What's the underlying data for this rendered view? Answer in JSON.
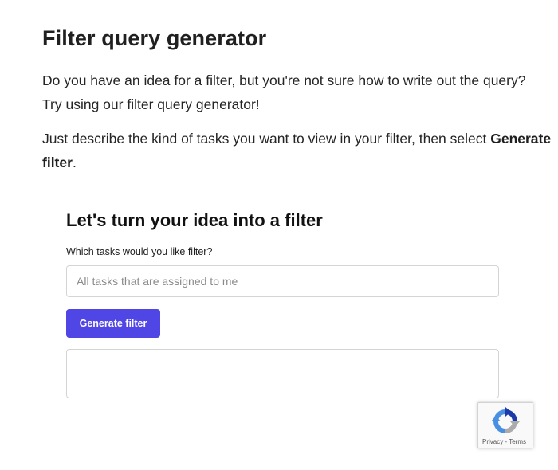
{
  "page": {
    "title": "Filter query generator",
    "intro": "Do you have an idea for a filter, but you're not sure how to write out the query? Try using our filter query generator!",
    "instruction_prefix": "Just describe the kind of tasks you want to view in your filter, then select ",
    "instruction_bold": "Generate filter",
    "instruction_suffix": "."
  },
  "generator": {
    "heading": "Let's turn your idea into a filter",
    "field_label": "Which tasks would you like filter?",
    "input_value": "",
    "input_placeholder": "All tasks that are assigned to me",
    "button_label": "Generate filter",
    "button_color": "#4f46e5",
    "result_text": ""
  },
  "recaptcha": {
    "icon": "recaptcha-icon",
    "privacy_label": "Privacy",
    "separator": " - ",
    "terms_label": "Terms"
  }
}
